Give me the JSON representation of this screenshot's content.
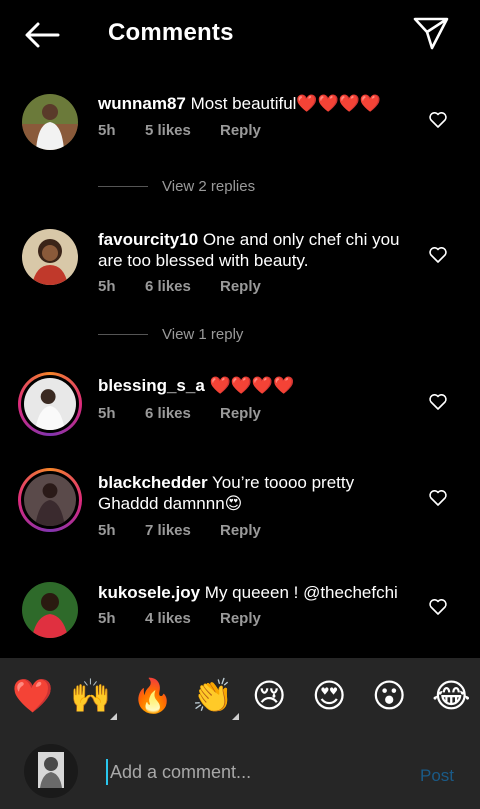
{
  "header": {
    "title": "Comments"
  },
  "comments": [
    {
      "username": "wunnam87",
      "text": "Most beautiful❤️❤️❤️❤️",
      "time": "5h",
      "likes": "5 likes",
      "reply": "Reply",
      "replies": "View 2 replies"
    },
    {
      "username": "favourcity10",
      "text": "One and only chef chi you are too blessed with beauty.",
      "time": "5h",
      "likes": "6 likes",
      "reply": "Reply",
      "replies": "View 1 reply"
    },
    {
      "username": "blessing_s_a",
      "text": "❤️❤️❤️❤️",
      "time": "5h",
      "likes": "6 likes",
      "reply": "Reply"
    },
    {
      "username": "blackchedder",
      "text": "You’re toooo pretty Ghaddd damnnn😍",
      "time": "5h",
      "likes": "7 likes",
      "reply": "Reply"
    },
    {
      "username": "kukosele.joy",
      "text": "My queeen ! @thechefchi",
      "time": "5h",
      "likes": "4 likes",
      "reply": "Reply"
    }
  ],
  "emoji_bar": [
    "❤️",
    "🙌",
    "🔥",
    "👏",
    "😢",
    "😍",
    "😮",
    "😂"
  ],
  "composer": {
    "placeholder": "Add a comment...",
    "post_label": "Post"
  }
}
